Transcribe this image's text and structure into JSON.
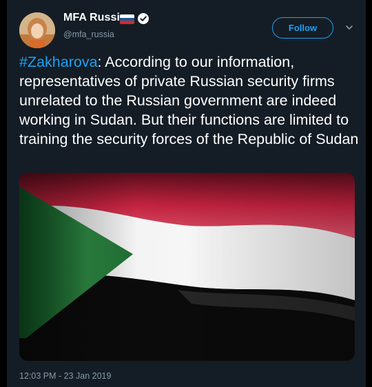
{
  "account": {
    "name": "MFA Russia",
    "handle": "@mfa_russia",
    "flag_colors": [
      "#ffffff",
      "#1c57a5",
      "#d52b1e"
    ],
    "verified_icon": "verified-badge-icon"
  },
  "actions": {
    "follow_label": "Follow",
    "menu_icon": "chevron-down-icon"
  },
  "tweet": {
    "hashtag": "#Zakharova",
    "text": ": According to our information, representatives of private Russian security firms unrelated to the Russian government are indeed working in Sudan. But their functions are limited to training the security forces of the Republic of Sudan",
    "media": {
      "description_icon": "sudan-flag-image",
      "colors": [
        "#d21034",
        "#ffffff",
        "#000000",
        "#007229"
      ]
    }
  },
  "meta": {
    "timestamp": "12:03 PM - 23 Jan 2019"
  },
  "theme": {
    "background": "#141d26",
    "accent": "#1da1f2",
    "muted": "#8899a6"
  }
}
